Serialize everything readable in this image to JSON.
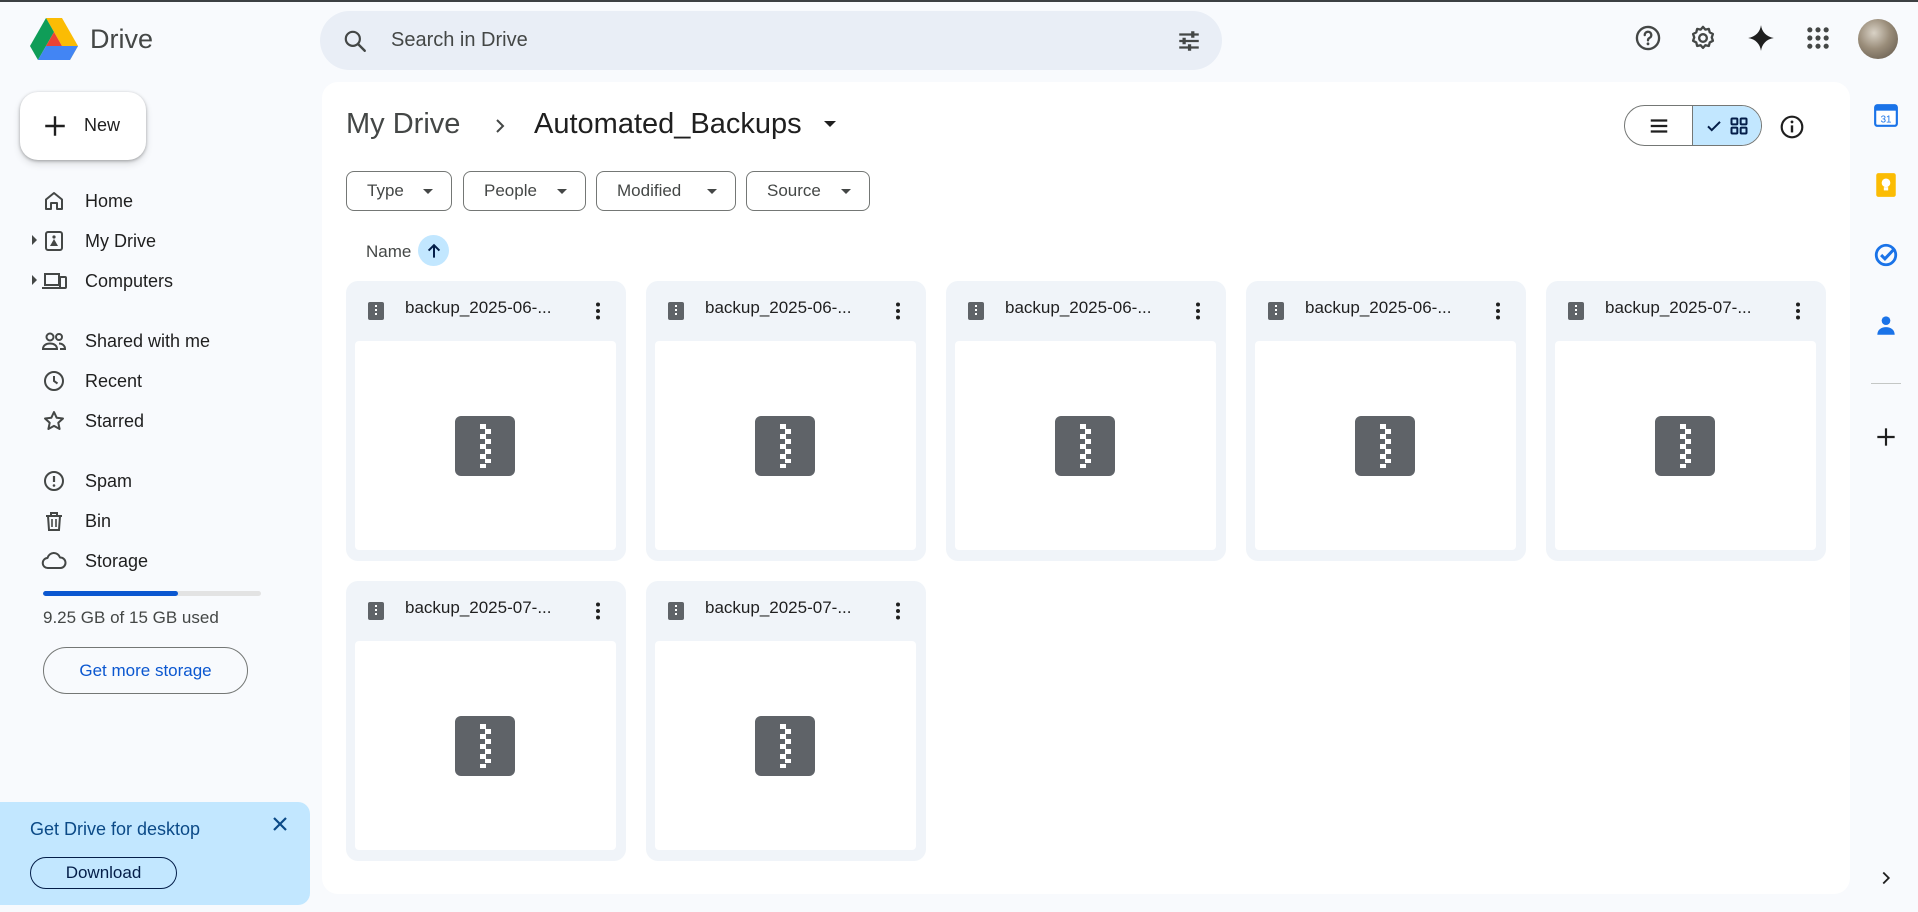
{
  "app": {
    "name": "Drive"
  },
  "search": {
    "placeholder": "Search in Drive"
  },
  "sidebar": {
    "new_label": "New",
    "primary": [
      {
        "label": "Home",
        "icon": "home-icon"
      },
      {
        "label": "My Drive",
        "icon": "my-drive-icon"
      },
      {
        "label": "Computers",
        "icon": "computers-icon"
      }
    ],
    "secondary": [
      {
        "label": "Shared with me",
        "icon": "shared-icon"
      },
      {
        "label": "Recent",
        "icon": "clock-icon"
      },
      {
        "label": "Starred",
        "icon": "star-icon"
      }
    ],
    "tertiary": [
      {
        "label": "Spam",
        "icon": "spam-icon"
      },
      {
        "label": "Bin",
        "icon": "bin-icon"
      },
      {
        "label": "Storage",
        "icon": "cloud-icon"
      }
    ],
    "storage": {
      "used_text": "9.25 GB of 15 GB used",
      "used_fraction": 0.617,
      "cta": "Get more storage"
    },
    "promo": {
      "title": "Get Drive for desktop",
      "button": "Download"
    }
  },
  "breadcrumb": {
    "root": "My Drive",
    "current": "Automated_Backups"
  },
  "filters": [
    "Type",
    "People",
    "Modified",
    "Source"
  ],
  "sort": {
    "label": "Name",
    "direction": "ascending"
  },
  "files": [
    {
      "name": "backup_2025-06-..."
    },
    {
      "name": "backup_2025-06-..."
    },
    {
      "name": "backup_2025-06-..."
    },
    {
      "name": "backup_2025-06-..."
    },
    {
      "name": "backup_2025-07-..."
    },
    {
      "name": "backup_2025-07-..."
    },
    {
      "name": "backup_2025-07-..."
    }
  ],
  "colors": {
    "accent": "#0b57d0",
    "selected": "#c2e7ff",
    "card": "#f0f4f9",
    "background": "#f8fafd"
  }
}
